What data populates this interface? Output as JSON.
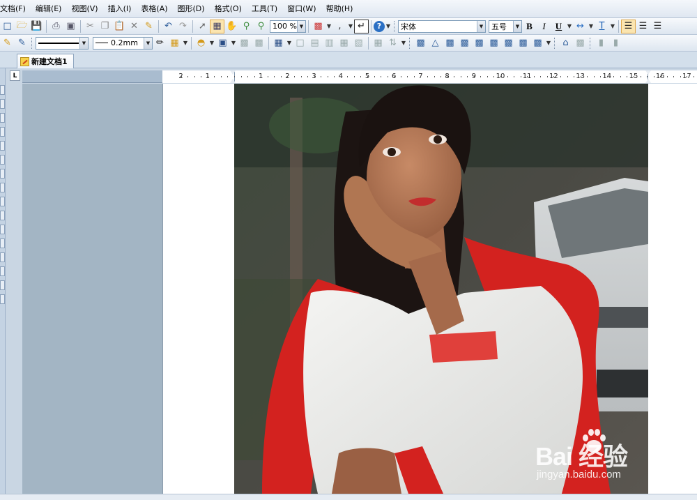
{
  "menubar": {
    "items": [
      "文档(F)",
      "编辑(E)",
      "视图(V)",
      "插入(I)",
      "表格(A)",
      "图形(D)",
      "格式(O)",
      "工具(T)",
      "窗口(W)",
      "帮助(H)"
    ]
  },
  "toolbar1": {
    "zoom": "100 %",
    "font_name": "宋体",
    "font_size": "五号",
    "bold_label": "B",
    "italic_label": "I",
    "underline_label": "U"
  },
  "toolbar2": {
    "line_width": "0.2mm"
  },
  "tabs": {
    "document": "新建文档1",
    "ruler_corner": "L"
  },
  "ruler": {
    "labels": [
      "2",
      "1",
      "1",
      "2",
      "3",
      "4",
      "5",
      "6",
      "7",
      "8",
      "9",
      "10",
      "11",
      "12",
      "13",
      "14",
      "15",
      "16",
      "17"
    ]
  },
  "watermark": {
    "brand": "Bai  经验",
    "url": "jingyan.baidu.com"
  },
  "colors": {
    "scarf_red": "#d3221f",
    "sidebar_blue": "#a3b5c4",
    "toolbar_bg": "#dde6f0",
    "accent_blue": "#2c5c9a"
  },
  "icons": [
    "new-document-icon",
    "open-folder-icon",
    "save-icon",
    "print-icon",
    "print-preview-icon",
    "cut-icon",
    "copy-icon",
    "paste-icon",
    "delete-icon",
    "format-painter-icon",
    "undo-icon",
    "redo-icon",
    "pointer-icon",
    "select-grid-icon",
    "hand-icon",
    "zoom-in-icon",
    "zoom-out-icon",
    "insert-image-icon",
    "paragraph-mark-icon",
    "help-icon",
    "align-left-icon",
    "align-center-icon",
    "align-right-icon"
  ]
}
